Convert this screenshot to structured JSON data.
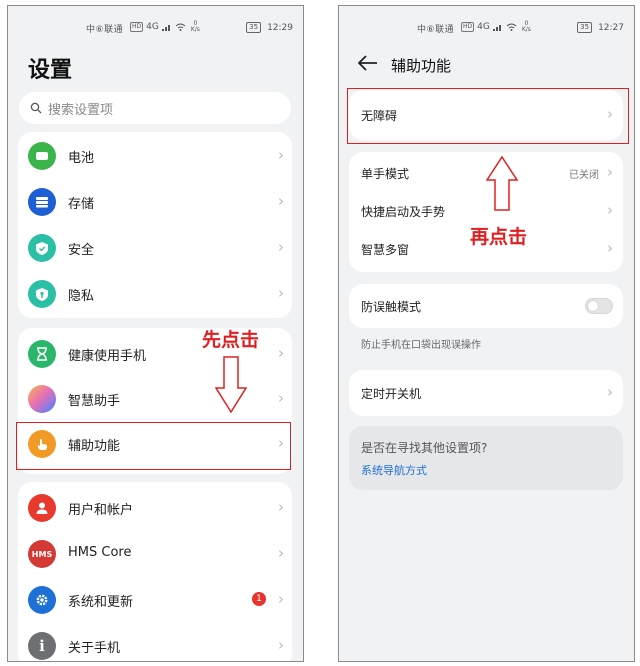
{
  "status_bar": {
    "carrier": "中⑥联通",
    "hd": "HD",
    "signal": "4G",
    "speed_value": "0",
    "speed_unit": "K/s",
    "battery": "35",
    "time_left": "12:29",
    "time_right": "12:27"
  },
  "left": {
    "title": "设置",
    "search_placeholder": "搜索设置项",
    "group1": [
      {
        "label": "电池",
        "icon": "battery-icon",
        "color": "#3bb54a"
      },
      {
        "label": "存储",
        "icon": "storage-icon",
        "color": "#1e5fd6"
      },
      {
        "label": "安全",
        "icon": "shield-icon",
        "color": "#2bc0a6"
      },
      {
        "label": "隐私",
        "icon": "privacy-icon",
        "color": "#2bc0a6"
      }
    ],
    "group2": [
      {
        "label": "健康使用手机",
        "icon": "hourglass-icon",
        "color": "#2bb76b"
      },
      {
        "label": "智慧助手",
        "icon": "assistant-icon",
        "color": "#a56bf0"
      },
      {
        "label": "辅助功能",
        "icon": "hand-icon",
        "color": "#f29a26"
      }
    ],
    "group3": [
      {
        "label": "用户和帐户",
        "icon": "user-icon",
        "color": "#e8392e"
      },
      {
        "label": "HMS Core",
        "icon": "hms-icon",
        "color": "#d33a35",
        "icon_text": "HMS"
      },
      {
        "label": "系统和更新",
        "icon": "gear-icon",
        "color": "#1e6fd6",
        "badge": "1"
      },
      {
        "label": "关于手机",
        "icon": "info-icon",
        "color": "#6d6f73",
        "icon_text": "i"
      }
    ],
    "annotation": "先点击"
  },
  "right": {
    "title": "辅助功能",
    "accessibility_label": "无障碍",
    "group2": [
      {
        "label": "单手模式",
        "status": "已关闭"
      },
      {
        "label": "快捷启动及手势"
      },
      {
        "label": "智慧多窗"
      }
    ],
    "mistouch_label": "防误触模式",
    "mistouch_hint": "防止手机在口袋出现误操作",
    "timer_label": "定时开关机",
    "suggest_question": "是否在寻找其他设置项?",
    "suggest_link": "系统导航方式",
    "annotation": "再点击"
  },
  "colors": {
    "annotation": "#e02020",
    "link": "#1f6fd6",
    "background": "#f1f2f4"
  }
}
